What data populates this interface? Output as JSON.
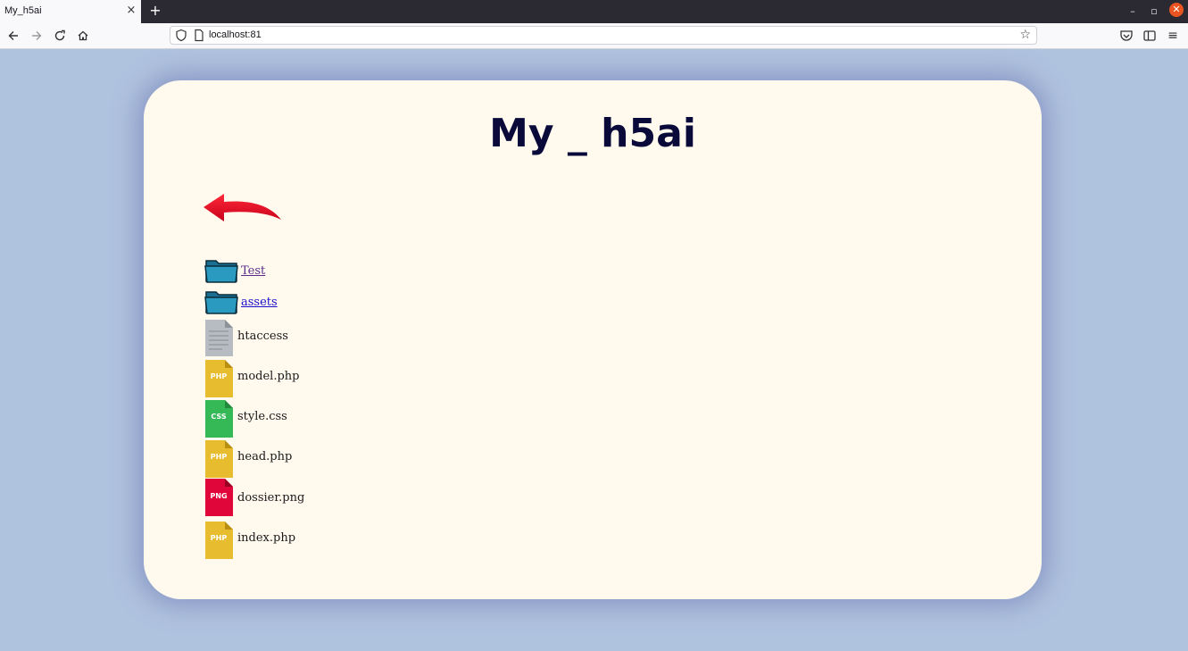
{
  "browser": {
    "tab_title": "My_h5ai",
    "tab_close": "×",
    "new_tab": "+",
    "url": "localhost:81",
    "window_min": "–",
    "window_max": "▫",
    "window_close": "✕"
  },
  "page": {
    "title": "My _ h5ai",
    "back_icon": "back-arrow-icon",
    "entries": [
      {
        "name": "Test",
        "type": "folder",
        "visited": true
      },
      {
        "name": "assets",
        "type": "folder",
        "visited": false
      },
      {
        "name": "htaccess",
        "type": "file",
        "badge": ""
      },
      {
        "name": "model.php",
        "type": "file",
        "badge": "PHP"
      },
      {
        "name": "style.css",
        "type": "file",
        "badge": "CSS"
      },
      {
        "name": "head.php",
        "type": "file",
        "badge": "PHP"
      },
      {
        "name": "dossier.png",
        "type": "file",
        "badge": "PNG"
      },
      {
        "name": "index.php",
        "type": "file",
        "badge": "PHP"
      }
    ]
  },
  "colors": {
    "background": "#afc2de",
    "card": "#fff9ee",
    "title": "#0a0a3a",
    "php": "#e7bc2e",
    "css": "#34b956",
    "png": "#e0063a",
    "generic_file": "#b7bcc2",
    "folder": "#2a8fb3",
    "arrow": "#ee0a1e"
  }
}
